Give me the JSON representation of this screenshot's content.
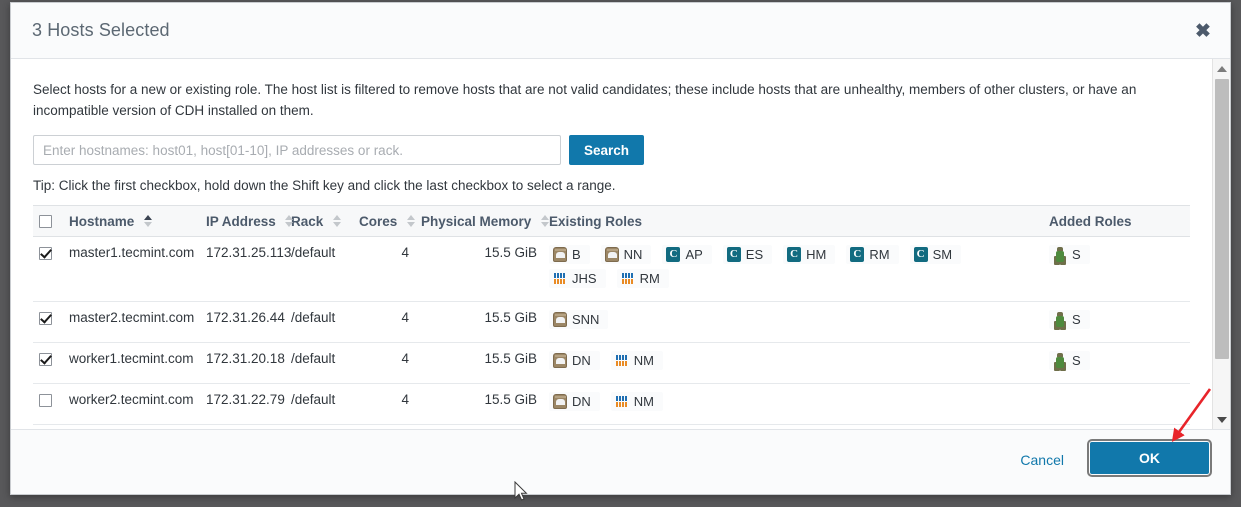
{
  "dialog": {
    "title": "3 Hosts Selected",
    "close_icon": "close-icon",
    "intro": "Select hosts for a new or existing role. The host list is filtered to remove hosts that are not valid candidates; these include hosts that are unhealthy, members of other clusters, or have an incompatible version of CDH installed on them.",
    "tip": "Tip: Click the first checkbox, hold down the Shift key and click the last checkbox to select a range."
  },
  "search": {
    "placeholder": "Enter hostnames: host01, host[01-10], IP addresses or rack.",
    "value": "",
    "button_label": "Search"
  },
  "table": {
    "columns": [
      {
        "key": "checkbox",
        "label": "",
        "sort": "none"
      },
      {
        "key": "hostname",
        "label": "Hostname",
        "sort": "asc"
      },
      {
        "key": "ip",
        "label": "IP Address",
        "sort": "none"
      },
      {
        "key": "rack",
        "label": "Rack",
        "sort": "none"
      },
      {
        "key": "cores",
        "label": "Cores",
        "sort": "none"
      },
      {
        "key": "memory",
        "label": "Physical Memory",
        "sort": "none"
      },
      {
        "key": "existing_roles",
        "label": "Existing Roles",
        "sort": "none"
      },
      {
        "key": "added_roles",
        "label": "Added Roles",
        "sort": "none"
      }
    ],
    "header_select_all_checked": false,
    "rows": [
      {
        "selected": true,
        "hostname": "master1.tecmint.com",
        "ip": "172.31.25.113",
        "rack": "/default",
        "cores": "4",
        "memory": "15.5 GiB",
        "existing_roles": [
          {
            "label": "B",
            "icon": "hdfs-icon"
          },
          {
            "label": "NN",
            "icon": "hdfs-icon"
          },
          {
            "label": "AP",
            "icon": "cloudera-management-icon"
          },
          {
            "label": "ES",
            "icon": "cloudera-management-icon"
          },
          {
            "label": "HM",
            "icon": "cloudera-management-icon"
          },
          {
            "label": "RM",
            "icon": "cloudera-management-icon"
          },
          {
            "label": "SM",
            "icon": "cloudera-management-icon"
          },
          {
            "label": "JHS",
            "icon": "yarn-icon"
          },
          {
            "label": "RM",
            "icon": "yarn-icon"
          }
        ],
        "added_roles": [
          {
            "label": "S",
            "icon": "zookeeper-icon"
          }
        ]
      },
      {
        "selected": true,
        "hostname": "master2.tecmint.com",
        "ip": "172.31.26.44",
        "rack": "/default",
        "cores": "4",
        "memory": "15.5 GiB",
        "existing_roles": [
          {
            "label": "SNN",
            "icon": "hdfs-icon"
          }
        ],
        "added_roles": [
          {
            "label": "S",
            "icon": "zookeeper-icon"
          }
        ]
      },
      {
        "selected": true,
        "hostname": "worker1.tecmint.com",
        "ip": "172.31.20.18",
        "rack": "/default",
        "cores": "4",
        "memory": "15.5 GiB",
        "existing_roles": [
          {
            "label": "DN",
            "icon": "hdfs-icon"
          },
          {
            "label": "NM",
            "icon": "yarn-icon"
          }
        ],
        "added_roles": [
          {
            "label": "S",
            "icon": "zookeeper-icon"
          }
        ]
      },
      {
        "selected": false,
        "hostname": "worker2.tecmint.com",
        "ip": "172.31.22.79",
        "rack": "/default",
        "cores": "4",
        "memory": "15.5 GiB",
        "existing_roles": [
          {
            "label": "DN",
            "icon": "hdfs-icon"
          },
          {
            "label": "NM",
            "icon": "yarn-icon"
          }
        ],
        "added_roles": []
      }
    ]
  },
  "footer": {
    "cancel_label": "Cancel",
    "ok_label": "OK"
  },
  "colors": {
    "accent": "#1178ab",
    "header_text": "#5c6873",
    "badge_teal": "#126b80",
    "annotation_red": "#e8242a"
  }
}
